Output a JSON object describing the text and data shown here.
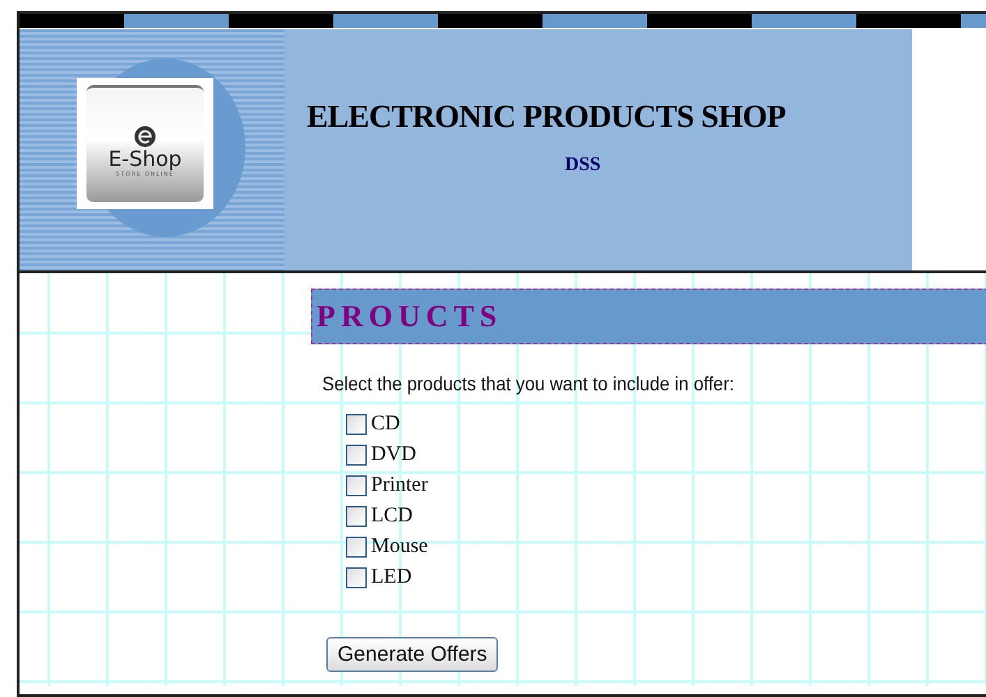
{
  "logo": {
    "name": "E-Shop",
    "tagline": "STORE ONLINE"
  },
  "header": {
    "title": "ELECTRONIC PRODUCTS SHOP",
    "subtitle": "DSS"
  },
  "section": {
    "title": "PROUCTS",
    "instruction": "Select the products that you want to include in offer:"
  },
  "products": [
    {
      "label": "CD",
      "checked": false
    },
    {
      "label": "DVD",
      "checked": false
    },
    {
      "label": "Printer",
      "checked": false
    },
    {
      "label": "LCD",
      "checked": false
    },
    {
      "label": "Mouse",
      "checked": false
    },
    {
      "label": "LED",
      "checked": false
    }
  ],
  "button": "Generate Offers"
}
